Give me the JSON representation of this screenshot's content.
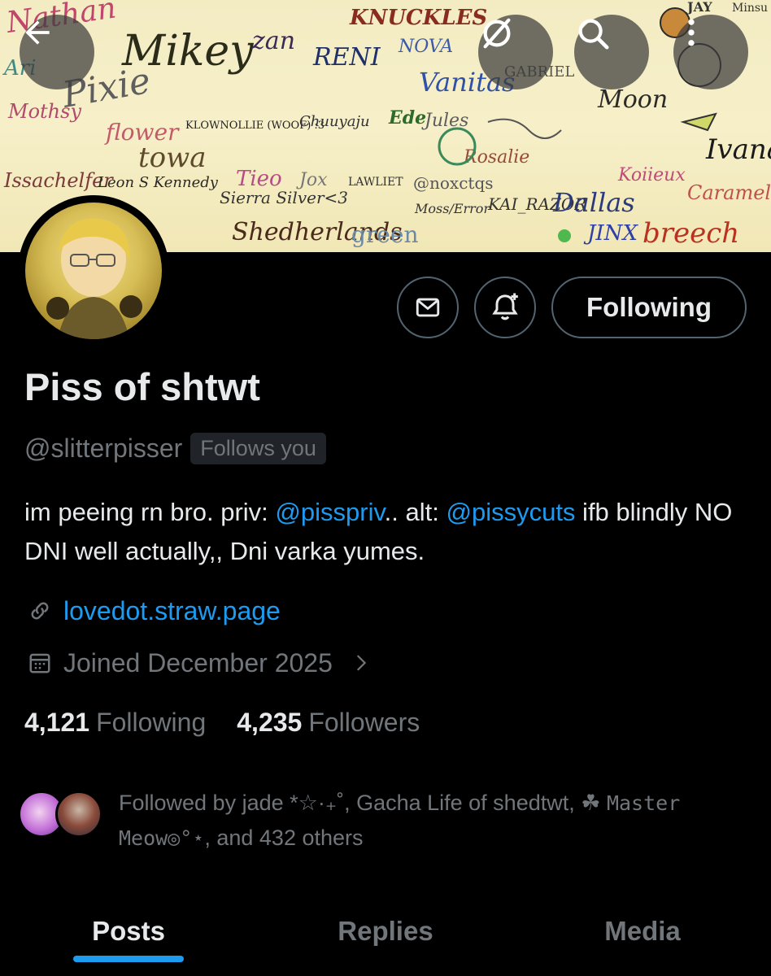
{
  "header": {
    "back_icon": "arrow-left-icon",
    "grok_icon": "grok-icon",
    "search_icon": "search-icon",
    "more_icon": "more-vertical-icon"
  },
  "banner": {
    "signatures": [
      "Nathan",
      "Mikey",
      "zan",
      "KNUCKLES",
      "RENI",
      "NOVA",
      "Vanitas",
      "Pixie",
      "Moon",
      "flower",
      "towa",
      "KLOWNOLLIE (WOOF) :3",
      "Chuuyaju",
      "Ede",
      "Jules",
      "Mothsy",
      "Issachelfer",
      "Tieo",
      "Jox",
      "LAWLIET",
      "@noxctqs",
      "KAI_RAZOR",
      "Dallas",
      "Sierra Silver<3",
      "Shedherlands",
      "green",
      "JINX",
      "breech",
      "Ivana",
      "Caramel",
      "Koiieux",
      "Moss/Error",
      "GABRIEL",
      "JAY",
      "Minsu",
      "Ari",
      "Leon S Kennedy",
      "Rosalie"
    ]
  },
  "profile": {
    "name": "Piss of shtwt",
    "handle": "@slitterpisser",
    "follows_you": "Follows you",
    "bio_prefix": "im peeing rn bro. priv: ",
    "bio_mention_1": "@pisspriv",
    "bio_mid": ".. alt: ",
    "bio_mention_2": "@pissycuts",
    "bio_suffix": " ifb blindly NO DNI well actually,, Dni varka yumes.",
    "link": "lovedot.straw.page",
    "joined": "Joined December 2025",
    "following_count": "4,121",
    "following_label": "Following",
    "followers_count": "4,235",
    "followers_label": "Followers",
    "followed_by_prefix": "Followed by jade *☆·₊˚, Gacha Life of shedtwt, ☘ ",
    "followed_by_mono": "Master Meow◎°⋆",
    "followed_by_suffix": ", and 432 others"
  },
  "actions": {
    "message_icon": "envelope-icon",
    "notify_icon": "bell-plus-icon",
    "following_label": "Following"
  },
  "tabs": [
    {
      "label": "Posts",
      "active": true
    },
    {
      "label": "Replies",
      "active": false
    },
    {
      "label": "Media",
      "active": false
    }
  ],
  "colors": {
    "accent": "#1d9bf0",
    "background": "#000000",
    "text": "#e7e9ea",
    "muted": "#71767b",
    "border": "#536471"
  }
}
